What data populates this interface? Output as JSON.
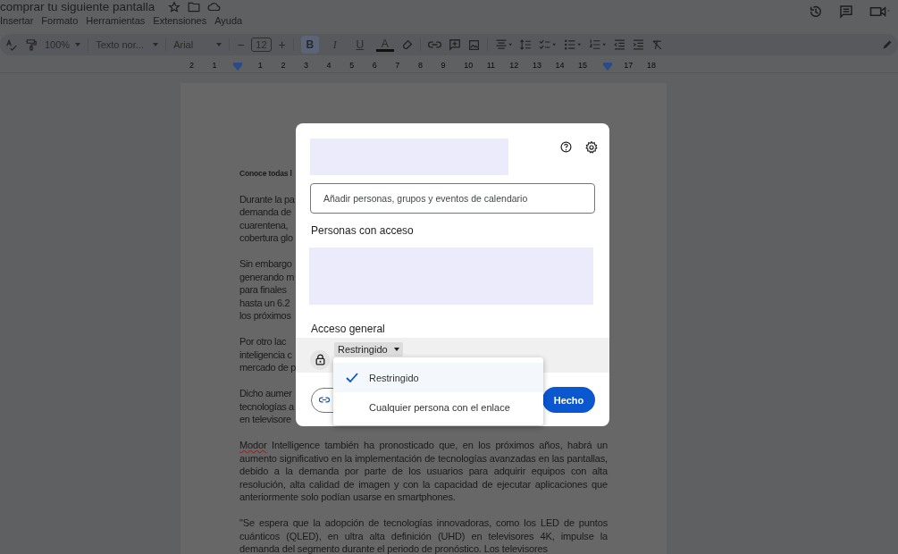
{
  "header": {
    "doc_title": "comprar tu siguiente pantalla",
    "menu": [
      "Insertar",
      "Formato",
      "Herramientas",
      "Extensiones",
      "Ayuda"
    ]
  },
  "toolbar": {
    "zoom": "100%",
    "style": "Texto nor...",
    "font": "Arial",
    "minus": "−",
    "font_size": "12",
    "plus": "+",
    "format_buttons": [
      {
        "label": "B",
        "kind": "bold",
        "selected": true
      },
      {
        "label": "I",
        "kind": "italic",
        "selected": false
      },
      {
        "label": "U",
        "kind": "underline",
        "selected": false
      },
      {
        "label": "A",
        "kind": "color",
        "selected": false
      }
    ]
  },
  "ruler": {
    "numbers": [
      "2",
      "1",
      "1",
      "2",
      "3",
      "4",
      "5",
      "6",
      "7",
      "8",
      "9",
      "10",
      "11",
      "12",
      "13",
      "14",
      "15",
      "17",
      "18"
    ]
  },
  "document": {
    "heading_fragment": "Conoce todas l",
    "covered_paragraphs": [
      [
        "Durante la pa",
        "demanda de",
        "cuarentena,",
        "cobertura glo"
      ],
      [
        "Sin embargo",
        "generando m",
        "para finales",
        "hasta un 6.2",
        "los próximos"
      ],
      [
        "Por otro lac",
        "inteligencia c",
        "mercado de p"
      ],
      [
        "Dicho aumer",
        "tecnologías a",
        "en televisore"
      ]
    ],
    "paragraphs": [
      {
        "flagged": "Modor",
        "text": " Intelligence también ha pronosticado que, en los próximos años, habrá un aumento significativo en la implementación de tecnologías avanzadas en las pantallas, debido a la demanda por parte de los usuarios para adquirir equipos con alta resolución, alta calidad de imagen y con la capacidad de ejecutar aplicaciones que anteriormente solo podían usarse en smartphones."
      },
      {
        "text": "\"Se espera que la adopción de tecnologías innovadoras, como los LED de puntos cuánticos (QLED), en ultra alta definición (UHD) en televisores 4K, impulse la demanda del segmento durante el periodo de pronóstico. Los televisores"
      }
    ]
  },
  "dialog": {
    "search_placeholder": "Añadir personas, grupos y eventos de calendario",
    "people_heading": "Personas con acceso",
    "general_heading": "Acceso general",
    "access_button": "Restringido",
    "done_button": "Hecho",
    "access_menu": [
      {
        "label": "Restringido",
        "selected": true
      },
      {
        "label": "Cualquier persona con el enlace",
        "selected": false
      }
    ]
  }
}
